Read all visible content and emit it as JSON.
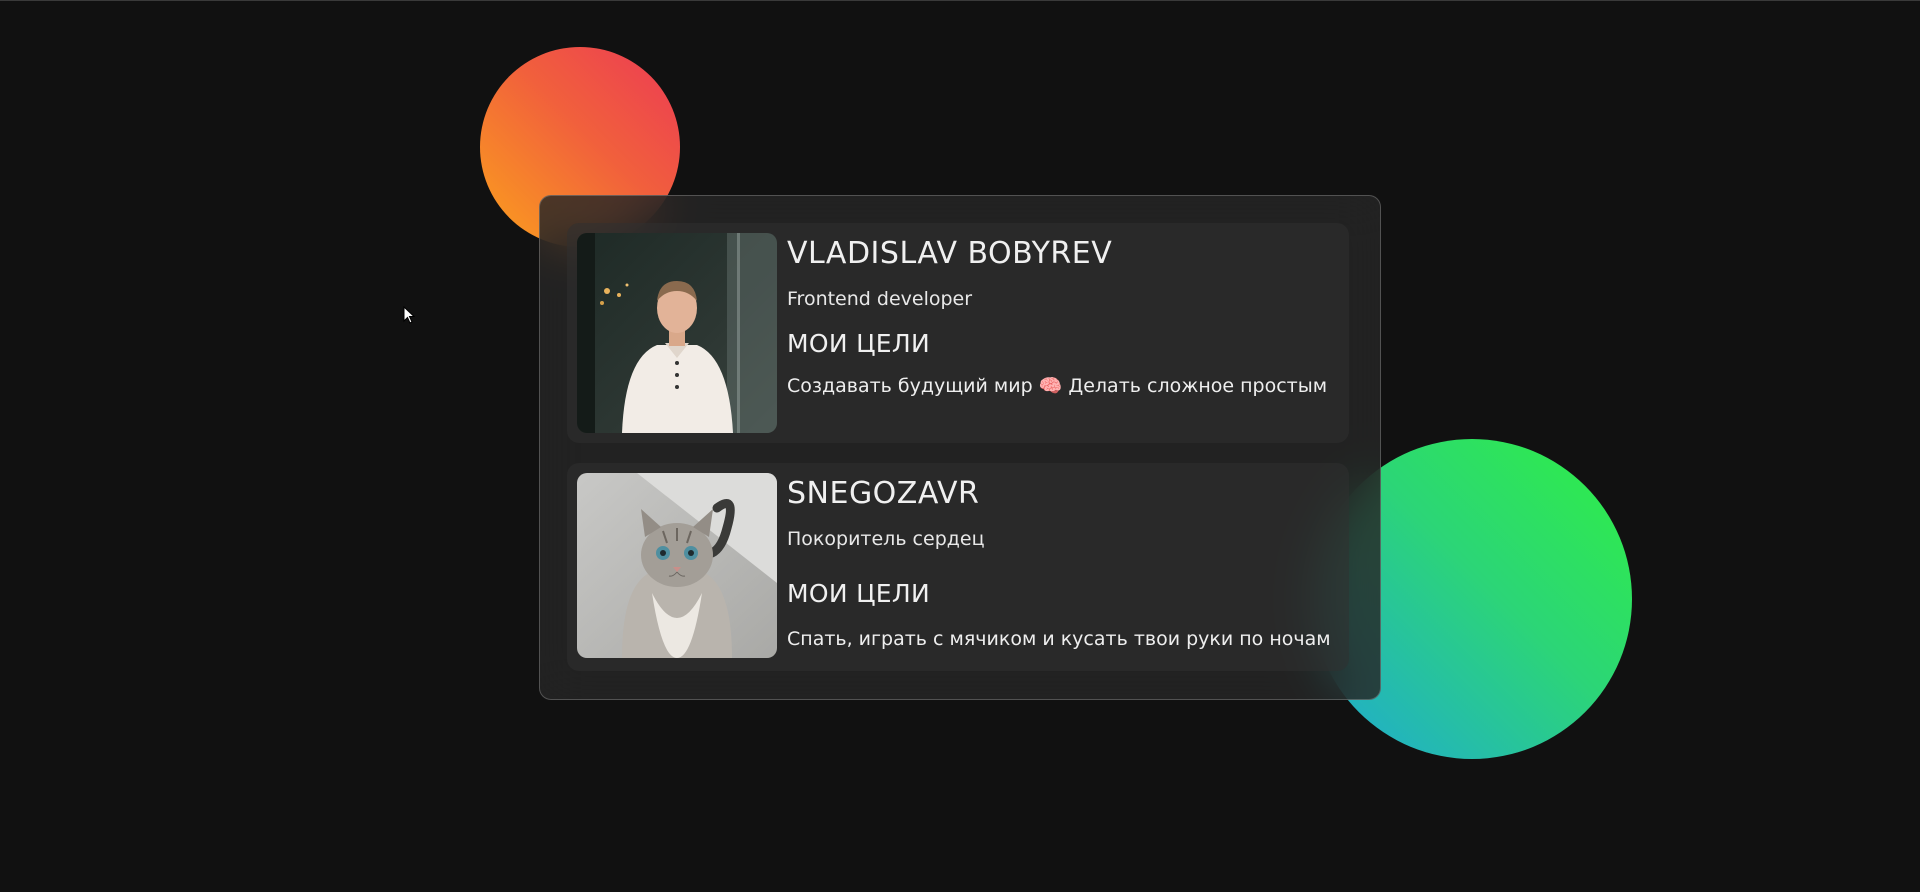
{
  "colors": {
    "background": "#111111",
    "orange_blob": [
      "#ec3a55",
      "#fba21c"
    ],
    "green_blob": [
      "#2ff043",
      "#1fa8d6"
    ]
  },
  "profiles": [
    {
      "name": "VLADISLAV BOBYREV",
      "role": "Frontend developer",
      "goals_title": "МОИ ЦЕЛИ",
      "goals": "Создавать будущий мир 🧠 Делать сложное простым",
      "photo": "man-portrait"
    },
    {
      "name": "SNEGOZAVR",
      "role": "Покоритель сердец",
      "goals_title": "МОИ ЦЕЛИ",
      "goals": "Спать, играть с мячиком и кусать твои руки по ночам",
      "photo": "cat-portrait"
    }
  ]
}
